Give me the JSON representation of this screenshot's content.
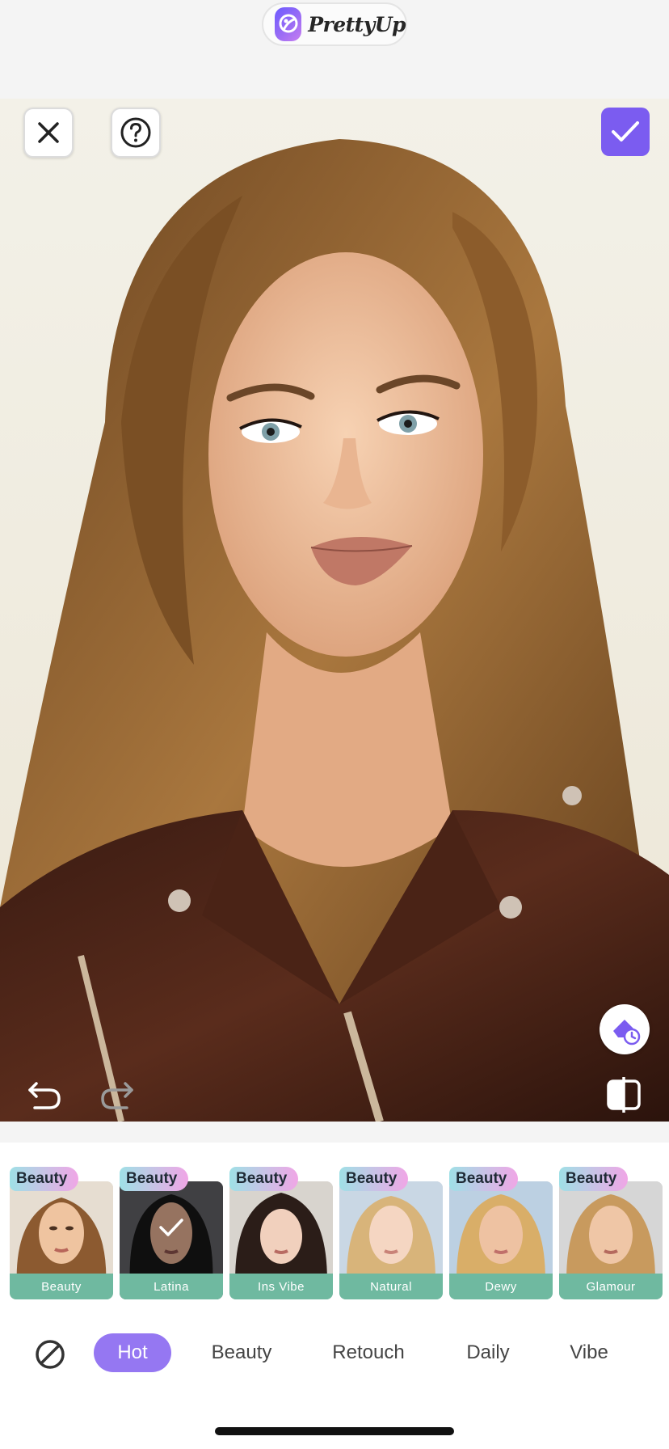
{
  "app": {
    "name": "PrettyUp"
  },
  "toolbar": {
    "close_icon": "close-icon",
    "help_icon": "help-icon",
    "confirm_icon": "checkmark-icon",
    "history_icon": "eraser-history-icon",
    "undo_icon": "undo-icon",
    "redo_icon": "redo-icon",
    "compare_icon": "compare-icon"
  },
  "presets": [
    {
      "tag": "Beauty",
      "label": "Beauty",
      "selected": false
    },
    {
      "tag": "Beauty",
      "label": "Latina",
      "selected": true
    },
    {
      "tag": "Beauty",
      "label": "Ins Vibe",
      "selected": false
    },
    {
      "tag": "Beauty",
      "label": "Natural",
      "selected": false
    },
    {
      "tag": "Beauty",
      "label": "Dewy",
      "selected": false
    },
    {
      "tag": "Beauty",
      "label": "Glamour",
      "selected": false
    }
  ],
  "tabs": {
    "none_icon": "no-filter-icon",
    "hot": "Hot",
    "beauty": "Beauty",
    "retouch": "Retouch",
    "daily": "Daily",
    "vibe": "Vibe",
    "active": "Hot"
  },
  "colors": {
    "accent": "#7b5cf0",
    "tab_active": "#9577f2",
    "preset_label": "#6fb9a0"
  }
}
